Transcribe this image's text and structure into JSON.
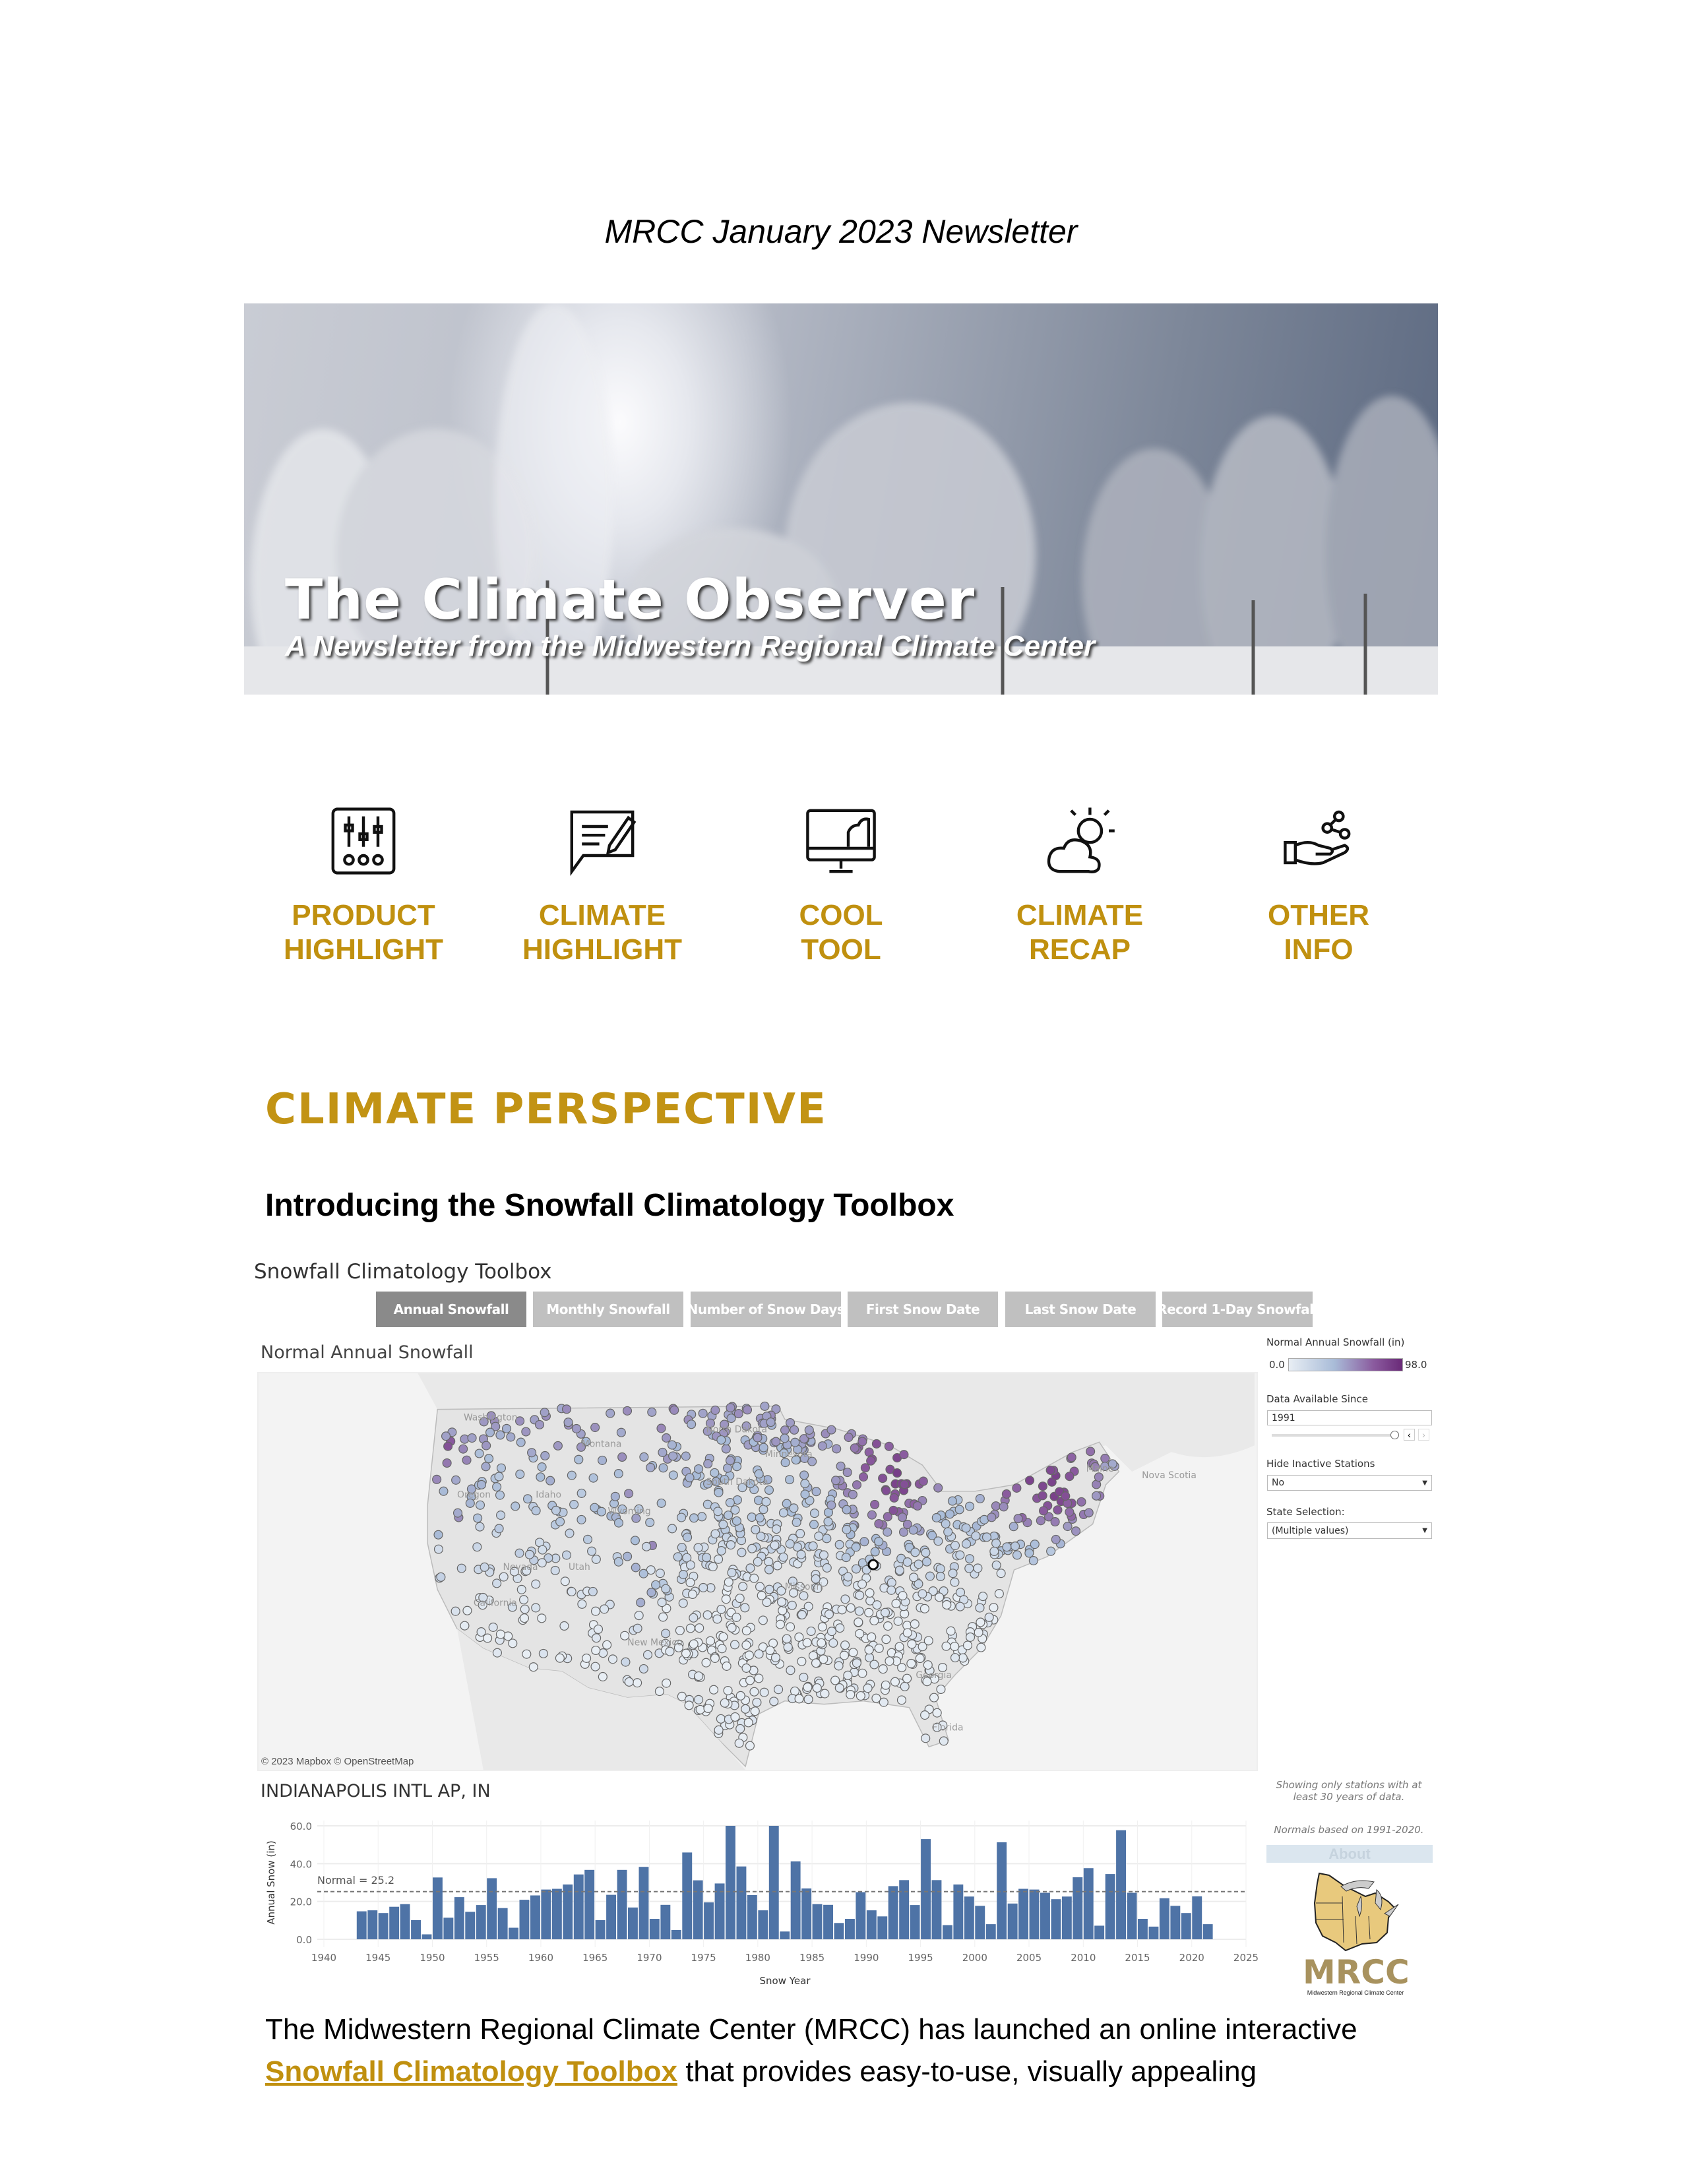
{
  "newsletter_title": "MRCC January 2023 Newsletter",
  "banner": {
    "title": "The Climate Observer",
    "subtitle": "A Newsletter from the Midwestern Regional Climate Center"
  },
  "nav": [
    {
      "line1": "PRODUCT",
      "line2": "HIGHLIGHT",
      "icon": "sliders-icon"
    },
    {
      "line1": "CLIMATE",
      "line2": "HIGHLIGHT",
      "icon": "speech-bubble-pen-icon"
    },
    {
      "line1": "COOL",
      "line2": "TOOL",
      "icon": "monitor-icon"
    },
    {
      "line1": "CLIMATE",
      "line2": "RECAP",
      "icon": "cloud-sun-icon"
    },
    {
      "line1": "OTHER",
      "line2": "INFO",
      "icon": "hand-share-icon"
    }
  ],
  "accent_color": "#c0900f",
  "section_heading": "CLIMATE PERSPECTIVE",
  "article_title": "Introducing the Snowfall Climatology Toolbox",
  "toolbox": {
    "title": "Snowfall Climatology Toolbox",
    "tabs": [
      "Annual Snowfall",
      "Monthly Snowfall",
      "Number of Snow Days",
      "First Snow Date",
      "Last Snow Date",
      "Record 1-Day Snowfall"
    ],
    "active_tab": "Annual Snowfall",
    "map_title": "Normal Annual Snowfall",
    "map_credit": "© 2023 Mapbox  © OpenStreetMap",
    "map_labels": [
      "Washington",
      "Montana",
      "North Dakota",
      "Minnesota",
      "South Dakota",
      "Oregon",
      "Idaho",
      "Wyoming",
      "Nevada",
      "Utah",
      "California",
      "New Mexico",
      "Missouri",
      "Georgia",
      "Florida",
      "Maine",
      "Nova Scotia"
    ],
    "legend": {
      "title": "Normal Annual Snowfall (in)",
      "min": "0.0",
      "max": "98.0",
      "color_low": "#e8eef4",
      "color_high": "#6a2a78"
    },
    "data_since": {
      "label": "Data Available Since",
      "value": "1991"
    },
    "hide_inactive": {
      "label": "Hide Inactive Stations",
      "value": "No"
    },
    "state_selection": {
      "label": "State Selection:",
      "value": "(Multiple values)"
    },
    "note1": "Showing only stations with at least 30 years of data.",
    "note2": "Normals based on 1991-2020.",
    "about_label": "About",
    "logo": {
      "text": "MRCC",
      "subtitle": "Midwestern Regional Climate Center"
    },
    "station_title": "INDIANAPOLIS INTL AP, IN"
  },
  "chart_data": {
    "type": "bar",
    "title": "INDIANAPOLIS INTL AP, IN",
    "xlabel": "Snow Year",
    "ylabel": "Annual Snow (in)",
    "xlim": [
      1940,
      2025
    ],
    "ylim": [
      0,
      60
    ],
    "xticks": [
      "1940",
      "1945",
      "1950",
      "1955",
      "1960",
      "1965",
      "1970",
      "1975",
      "1980",
      "1985",
      "1990",
      "1995",
      "2000",
      "2005",
      "2010",
      "2015",
      "2020",
      "2025"
    ],
    "yticks": [
      "0.0",
      "20.0",
      "40.0",
      "60.0"
    ],
    "reference_line": {
      "label": "Normal = 25.2",
      "value": 25.2
    },
    "bar_color": "#4e73a6",
    "grid": true,
    "x": [
      1943,
      1944,
      1945,
      1946,
      1947,
      1948,
      1949,
      1950,
      1951,
      1952,
      1953,
      1954,
      1955,
      1956,
      1957,
      1958,
      1959,
      1960,
      1961,
      1962,
      1963,
      1964,
      1965,
      1966,
      1967,
      1968,
      1969,
      1970,
      1971,
      1972,
      1973,
      1974,
      1975,
      1976,
      1977,
      1978,
      1979,
      1980,
      1981,
      1982,
      1983,
      1984,
      1985,
      1986,
      1987,
      1988,
      1989,
      1990,
      1991,
      1992,
      1993,
      1994,
      1995,
      1996,
      1997,
      1998,
      1999,
      2000,
      2001,
      2002,
      2003,
      2004,
      2005,
      2006,
      2007,
      2008,
      2009,
      2010,
      2011,
      2012,
      2013,
      2014,
      2015,
      2016,
      2017,
      2018,
      2019,
      2020,
      2021
    ],
    "values": [
      14.8,
      15.3,
      13.9,
      17.2,
      18.6,
      10.1,
      2.6,
      32.7,
      11.4,
      22.3,
      14.5,
      18.1,
      32.3,
      16.5,
      6.1,
      20.9,
      23.2,
      26.3,
      26.7,
      29.0,
      34.3,
      36.7,
      10.1,
      23.5,
      36.7,
      16.8,
      38.3,
      10.8,
      18.2,
      4.9,
      45.9,
      31.2,
      19.5,
      29.5,
      60.0,
      38.5,
      23.4,
      15.3,
      60.0,
      4.1,
      41.2,
      26.9,
      18.6,
      18.2,
      8.6,
      10.8,
      24.9,
      15.3,
      12.1,
      28.1,
      31.3,
      18.1,
      53.0,
      31.3,
      7.5,
      29.0,
      22.6,
      17.7,
      8.0,
      51.3,
      18.9,
      26.7,
      26.3,
      24.6,
      21.2,
      22.6,
      32.8,
      37.6,
      7.2,
      34.5,
      57.7,
      24.6,
      10.8,
      6.7,
      21.7,
      17.7,
      13.9,
      22.7,
      8.0
    ]
  },
  "paragraph": {
    "text1": "The Midwestern Regional Climate Center (MRCC) has launched an online interactive ",
    "link": "Snowfall Climatology Toolbox",
    "text2": " that provides easy-to-use, visually appealing"
  }
}
